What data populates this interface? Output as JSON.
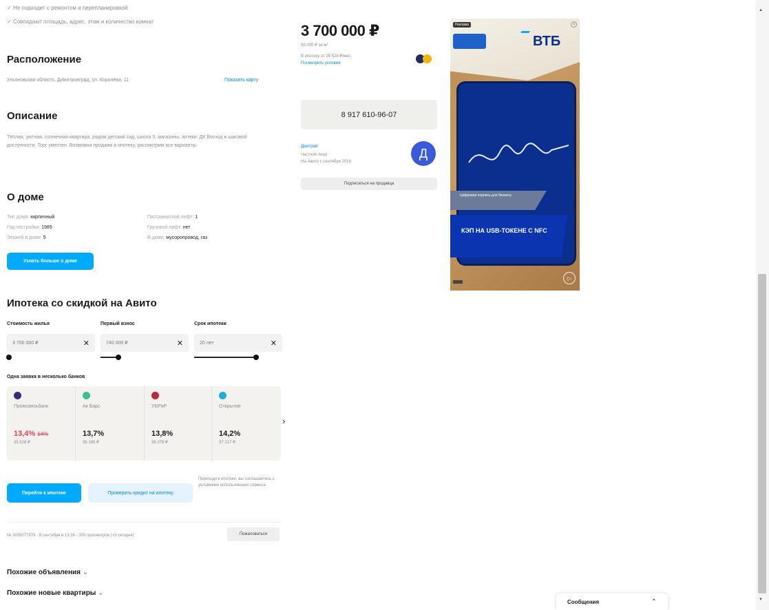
{
  "top": {
    "line1": "Не подходит с ремонтом и перепланировкой",
    "line2": "Совпадают площадь, адрес, этаж и количество комнат"
  },
  "location": {
    "title": "Расположение",
    "address": "Ульяновская область, Димитровград, ул. Королёва, 11",
    "map_link": "Показать карту"
  },
  "description": {
    "title": "Описание",
    "text": "Тёплая, уютная, солнечная квартира, рядом детский сад, школа 5, магазины, аптеки. ДК Восход в шаговой доступности. Торг уместен. Возможна продажа в ипотеку, рассмотрим все варианты."
  },
  "house": {
    "title": "О доме",
    "left": [
      {
        "k": "Тип дома:",
        "v": "кирпичный"
      },
      {
        "k": "Год постройки:",
        "v": "1985"
      },
      {
        "k": "Этажей в доме:",
        "v": "5"
      }
    ],
    "right": [
      {
        "k": "Пассажирский лифт:",
        "v": "1"
      },
      {
        "k": "Грузовой лифт:",
        "v": "нет"
      },
      {
        "k": "В доме:",
        "v": "мусоропровод, газ"
      }
    ],
    "more_button": "Узнать больше о доме"
  },
  "mortgage": {
    "title": "Ипотека со скидкой на Авито",
    "fields": [
      {
        "label": "Стоимость жилья",
        "value": "3 700 000 ₽",
        "fill": 0.02
      },
      {
        "label": "Первый взнос",
        "value": "740 000 ₽",
        "fill": 0.2
      },
      {
        "label": "Срок ипотеки",
        "value": "20 лет",
        "fill": 0.7
      }
    ],
    "banks_caption": "Одна заявка в несколько банков",
    "banks": [
      {
        "name": "Промсвязьбанк",
        "rate": "13,4%",
        "old_rate": "14%",
        "payment": "35 528 ₽",
        "color": "#3a2a7a"
      },
      {
        "name": "Ак Барс",
        "rate": "13,7%",
        "old_rate": "",
        "payment": "36 165 ₽",
        "color": "#38c08a"
      },
      {
        "name": "УБРиР",
        "rate": "13,8%",
        "old_rate": "",
        "payment": "36 379 ₽",
        "color": "#c0263e"
      },
      {
        "name": "Открытие",
        "rate": "14,2%",
        "old_rate": "",
        "payment": "37 217 ₽",
        "color": "#18b3d6"
      }
    ],
    "go_button": "Перейти к ипотеке",
    "check_button": "Проверить кредит на ипотеку",
    "note": "Переходя к ипотеке, вы соглашаетесь с условиями использования сервиса"
  },
  "footer_meta": {
    "text": "№ 3039077979 · 8 сентября в 13:36 · 305 просмотров (+3 сегодня)",
    "complain": "Пожаловаться"
  },
  "similar": {
    "ads": "Похожие объявления",
    "new_flats": "Похожие новые квартиры"
  },
  "price": {
    "value": "3 700 000 ₽",
    "per_m2": "59 000 ₽ за м²",
    "mortgage_line": "В ипотеку от 35 528 ₽/мес.",
    "details_link": "Посмотреть условия"
  },
  "phone": {
    "number": "8 917 610-96-07"
  },
  "seller": {
    "name": "Дмитрий",
    "type": "Частное лицо",
    "since": "На Авито с сентября 2016",
    "avatar_letter": "Д",
    "subscribe": "Подписаться на продавца"
  },
  "ad": {
    "brand": "ВТБ",
    "tag": "Реклама",
    "banner_small": "Цифровая подпись для бизнеса",
    "banner_big": "КЭП НА USB-ТОКЕНЕ С NFC"
  },
  "messages": {
    "label": "Сообщения"
  }
}
